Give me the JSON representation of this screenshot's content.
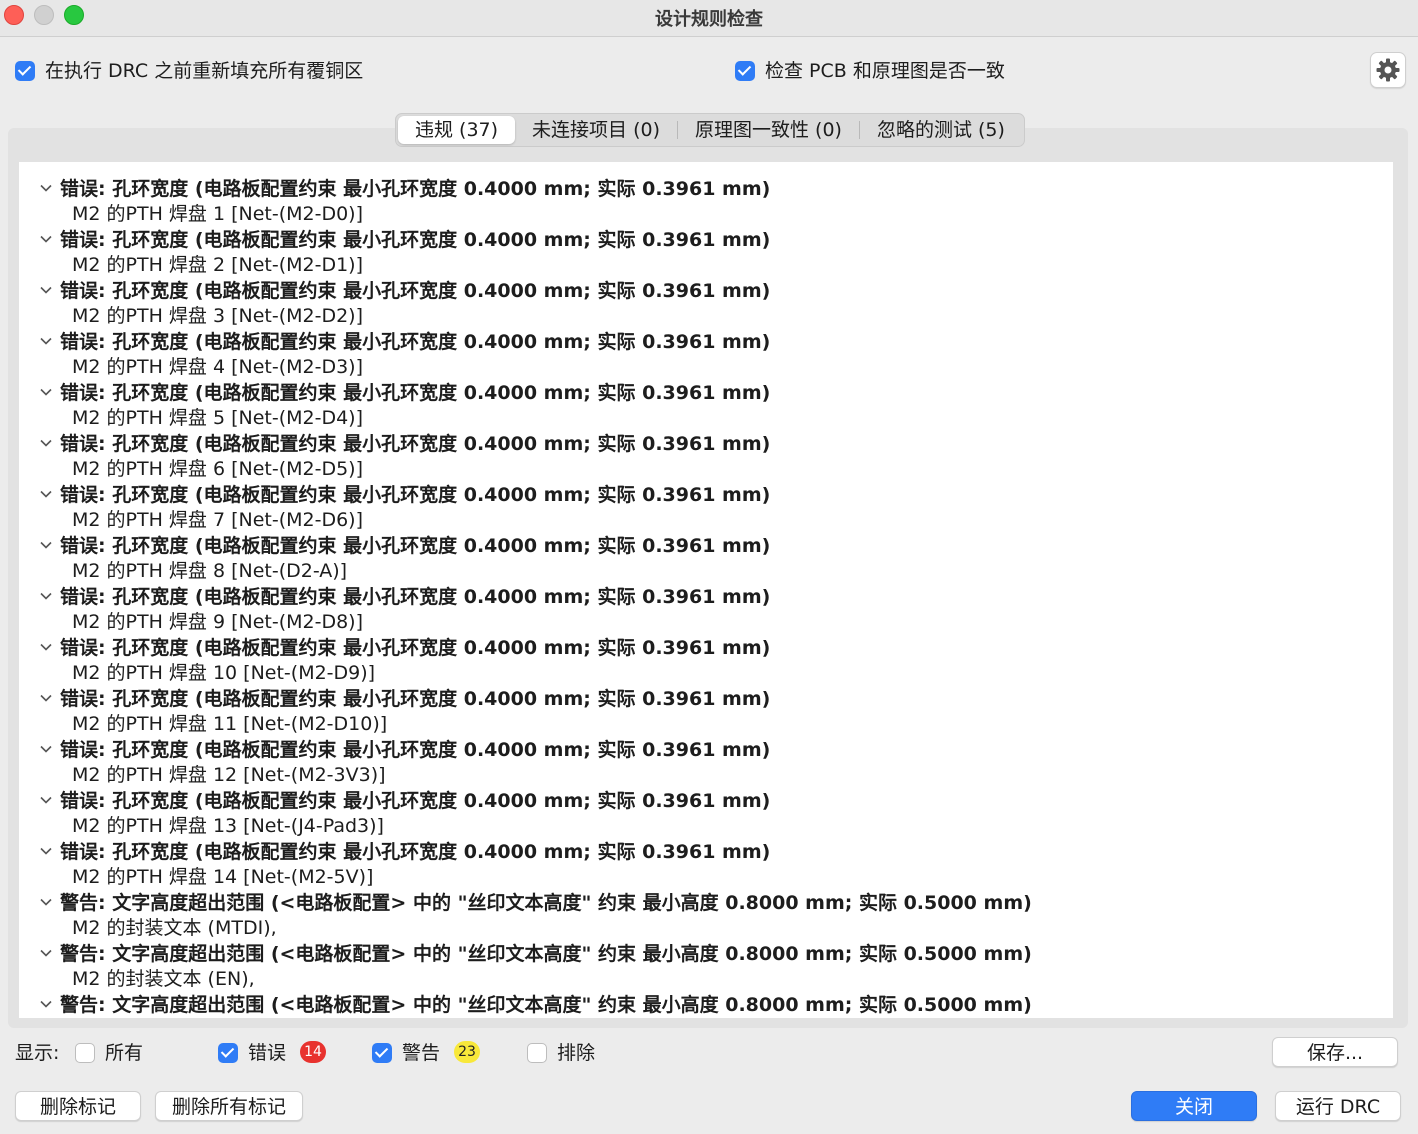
{
  "window": {
    "title": "设计规则检查"
  },
  "options": {
    "refill_zones": {
      "label": "在执行 DRC 之前重新填充所有覆铜区",
      "checked": true
    },
    "check_parity": {
      "label": "检查 PCB 和原理图是否一致",
      "checked": true
    }
  },
  "tabs": [
    {
      "label": "违规 (37)",
      "active": true
    },
    {
      "label": "未连接项目 (0)",
      "active": false
    },
    {
      "label": "原理图一致性 (0)",
      "active": false
    },
    {
      "label": "忽略的测试 (5)",
      "active": false
    }
  ],
  "violations": [
    {
      "title": "错误: 孔环宽度 (电路板配置约束 最小孔环宽度 0.4000 mm; 实际 0.3961 mm)",
      "detail": "M2 的PTH 焊盘 1 [Net-(M2-D0)]"
    },
    {
      "title": "错误: 孔环宽度 (电路板配置约束 最小孔环宽度 0.4000 mm; 实际 0.3961 mm)",
      "detail": "M2 的PTH 焊盘 2 [Net-(M2-D1)]"
    },
    {
      "title": "错误: 孔环宽度 (电路板配置约束 最小孔环宽度 0.4000 mm; 实际 0.3961 mm)",
      "detail": "M2 的PTH 焊盘 3 [Net-(M2-D2)]"
    },
    {
      "title": "错误: 孔环宽度 (电路板配置约束 最小孔环宽度 0.4000 mm; 实际 0.3961 mm)",
      "detail": "M2 的PTH 焊盘 4 [Net-(M2-D3)]"
    },
    {
      "title": "错误: 孔环宽度 (电路板配置约束 最小孔环宽度 0.4000 mm; 实际 0.3961 mm)",
      "detail": "M2 的PTH 焊盘 5 [Net-(M2-D4)]"
    },
    {
      "title": "错误: 孔环宽度 (电路板配置约束 最小孔环宽度 0.4000 mm; 实际 0.3961 mm)",
      "detail": "M2 的PTH 焊盘 6 [Net-(M2-D5)]"
    },
    {
      "title": "错误: 孔环宽度 (电路板配置约束 最小孔环宽度 0.4000 mm; 实际 0.3961 mm)",
      "detail": "M2 的PTH 焊盘 7 [Net-(M2-D6)]"
    },
    {
      "title": "错误: 孔环宽度 (电路板配置约束 最小孔环宽度 0.4000 mm; 实际 0.3961 mm)",
      "detail": "M2 的PTH 焊盘 8 [Net-(D2-A)]"
    },
    {
      "title": "错误: 孔环宽度 (电路板配置约束 最小孔环宽度 0.4000 mm; 实际 0.3961 mm)",
      "detail": "M2 的PTH 焊盘 9 [Net-(M2-D8)]"
    },
    {
      "title": "错误: 孔环宽度 (电路板配置约束 最小孔环宽度 0.4000 mm; 实际 0.3961 mm)",
      "detail": "M2 的PTH 焊盘 10 [Net-(M2-D9)]"
    },
    {
      "title": "错误: 孔环宽度 (电路板配置约束 最小孔环宽度 0.4000 mm; 实际 0.3961 mm)",
      "detail": "M2 的PTH 焊盘 11 [Net-(M2-D10)]"
    },
    {
      "title": "错误: 孔环宽度 (电路板配置约束 最小孔环宽度 0.4000 mm; 实际 0.3961 mm)",
      "detail": "M2 的PTH 焊盘 12 [Net-(M2-3V3)]"
    },
    {
      "title": "错误: 孔环宽度 (电路板配置约束 最小孔环宽度 0.4000 mm; 实际 0.3961 mm)",
      "detail": "M2 的PTH 焊盘 13 [Net-(J4-Pad3)]"
    },
    {
      "title": "错误: 孔环宽度 (电路板配置约束 最小孔环宽度 0.4000 mm; 实际 0.3961 mm)",
      "detail": "M2 的PTH 焊盘 14 [Net-(M2-5V)]"
    },
    {
      "title": "警告: 文字高度超出范围 (<电路板配置> 中的 \"丝印文本高度\" 约束 最小高度 0.8000 mm; 实际 0.5000 mm)",
      "detail": "M2 的封装文本 (MTDI),"
    },
    {
      "title": "警告: 文字高度超出范围 (<电路板配置> 中的 \"丝印文本高度\" 约束 最小高度 0.8000 mm; 实际 0.5000 mm)",
      "detail": "M2 的封装文本 (EN),"
    },
    {
      "title": "警告: 文字高度超出范围 (<电路板配置> 中的 \"丝印文本高度\" 约束 最小高度 0.8000 mm; 实际 0.5000 mm)",
      "detail": ""
    }
  ],
  "filters": {
    "show_label": "显示:",
    "all": {
      "label": "所有",
      "checked": false
    },
    "errors": {
      "label": "错误",
      "checked": true,
      "count": "14"
    },
    "warnings": {
      "label": "警告",
      "checked": true,
      "count": "23"
    },
    "exclusions": {
      "label": "排除",
      "checked": false
    }
  },
  "buttons": {
    "save": "保存...",
    "delete_marker": "删除标记",
    "delete_all_markers": "删除所有标记",
    "close": "关闭",
    "run_drc": "运行 DRC"
  },
  "colors": {
    "accent": "#2f7cf6",
    "error_badge": "#e8322e",
    "warning_badge": "#f8e83a"
  }
}
